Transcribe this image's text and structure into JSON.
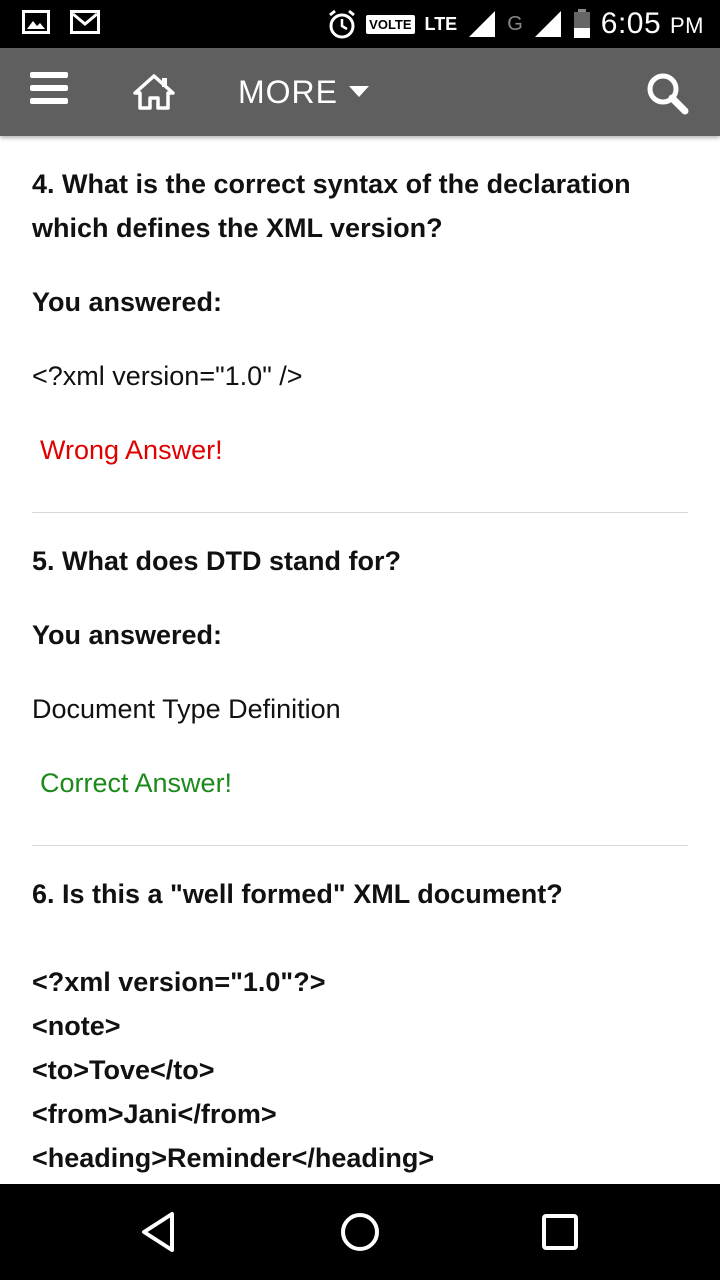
{
  "status_bar": {
    "volte": "VOLTE",
    "lte": "LTE",
    "network": "G",
    "time": "6:05",
    "ampm": "PM",
    "icons": [
      "image-icon",
      "gmail-icon",
      "alarm-icon",
      "signal-icon",
      "battery-icon"
    ]
  },
  "app_bar": {
    "more_label": "MORE",
    "icons": [
      "menu-icon",
      "home-icon",
      "caret-down-icon",
      "search-icon"
    ],
    "background": "#5f5f5f"
  },
  "questions": [
    {
      "title": "4. What is the correct syntax of the declaration which defines the XML version?",
      "label": "You answered:",
      "answer": "<?xml version=\"1.0\" />",
      "result": "Wrong Answer!",
      "result_color": "#e00000"
    },
    {
      "title": "5. What does DTD stand for?",
      "label": "You answered:",
      "answer": "Document Type Definition",
      "result": "Correct Answer!",
      "result_color": "#1b8a1b"
    },
    {
      "title": "6. Is this a \"well formed\" XML document?",
      "code_lines": [
        "<?xml version=\"1.0\"?>",
        "<note>",
        "<to>Tove</to>",
        "<from>Jani</from>",
        "<heading>Reminder</heading>"
      ]
    }
  ],
  "nav_bar": {
    "icons": [
      "back-icon",
      "home-circle-icon",
      "recents-icon"
    ]
  }
}
